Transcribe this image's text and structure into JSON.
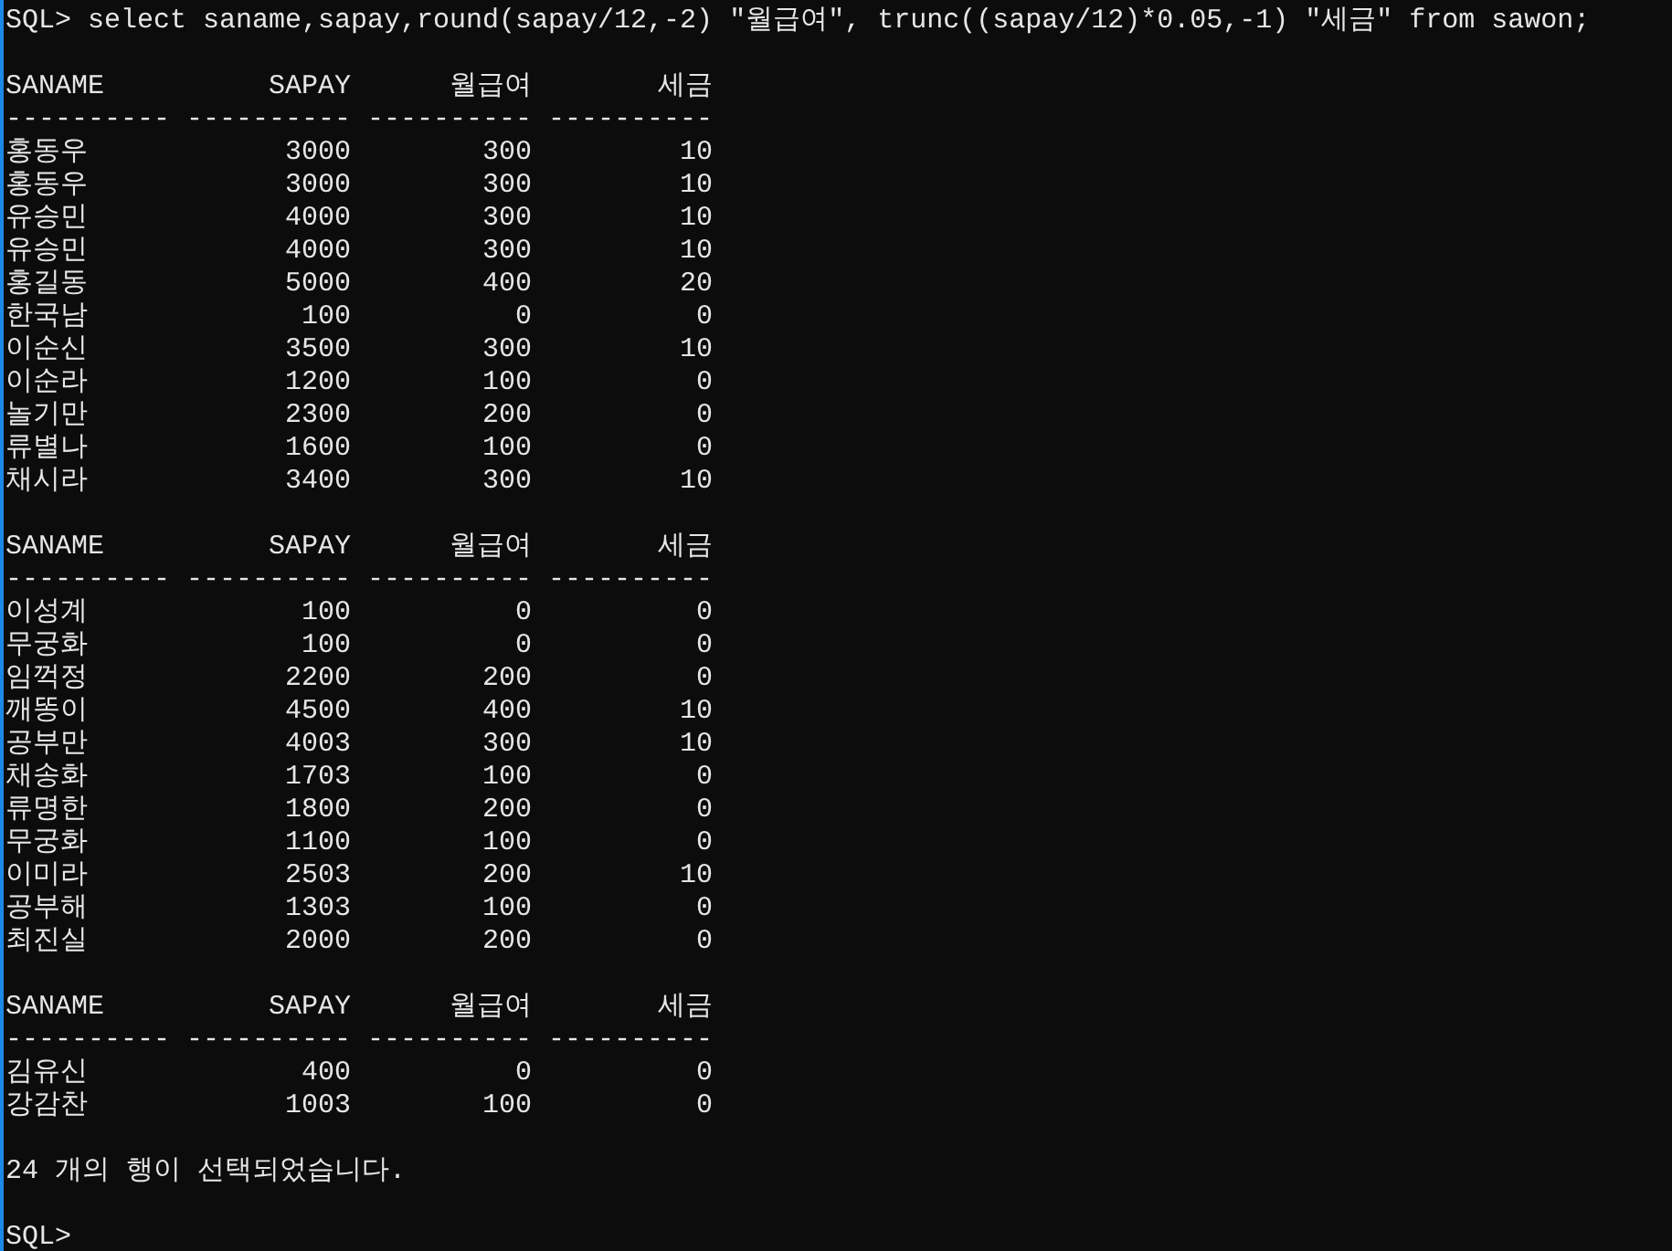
{
  "command_line": "SQL> select saname,sapay,round(sapay/12,-2) \"월급여\", trunc((sapay/12)*0.05,-1) \"세금\" from sawon;",
  "groups": [
    {
      "columns": [
        "SANAME",
        "SAPAY",
        "월급여",
        "세금"
      ],
      "separators": [
        "----------",
        "----------",
        "----------",
        "----------"
      ],
      "rows": [
        [
          "홍동우",
          "3000",
          "300",
          "10"
        ],
        [
          "홍동우",
          "3000",
          "300",
          "10"
        ],
        [
          "유승민",
          "4000",
          "300",
          "10"
        ],
        [
          "유승민",
          "4000",
          "300",
          "10"
        ],
        [
          "홍길동",
          "5000",
          "400",
          "20"
        ],
        [
          "한국남",
          "100",
          "0",
          "0"
        ],
        [
          "이순신",
          "3500",
          "300",
          "10"
        ],
        [
          "이순라",
          "1200",
          "100",
          "0"
        ],
        [
          "놀기만",
          "2300",
          "200",
          "0"
        ],
        [
          "류별나",
          "1600",
          "100",
          "0"
        ],
        [
          "채시라",
          "3400",
          "300",
          "10"
        ]
      ]
    },
    {
      "columns": [
        "SANAME",
        "SAPAY",
        "월급여",
        "세금"
      ],
      "separators": [
        "----------",
        "----------",
        "----------",
        "----------"
      ],
      "rows": [
        [
          "이성계",
          "100",
          "0",
          "0"
        ],
        [
          "무궁화",
          "100",
          "0",
          "0"
        ],
        [
          "임꺽정",
          "2200",
          "200",
          "0"
        ],
        [
          "깨똥이",
          "4500",
          "400",
          "10"
        ],
        [
          "공부만",
          "4003",
          "300",
          "10"
        ],
        [
          "채송화",
          "1703",
          "100",
          "0"
        ],
        [
          "류명한",
          "1800",
          "200",
          "0"
        ],
        [
          "무궁화",
          "1100",
          "100",
          "0"
        ],
        [
          "이미라",
          "2503",
          "200",
          "10"
        ],
        [
          "공부해",
          "1303",
          "100",
          "0"
        ],
        [
          "최진실",
          "2000",
          "200",
          "0"
        ]
      ]
    },
    {
      "columns": [
        "SANAME",
        "SAPAY",
        "월급여",
        "세금"
      ],
      "separators": [
        "----------",
        "----------",
        "----------",
        "----------"
      ],
      "rows": [
        [
          "김유신",
          "400",
          "0",
          "0"
        ],
        [
          "강감찬",
          "1003",
          "100",
          "0"
        ]
      ]
    }
  ],
  "result_message": "24 개의 행이 선택되었습니다.",
  "prompt": "SQL>"
}
